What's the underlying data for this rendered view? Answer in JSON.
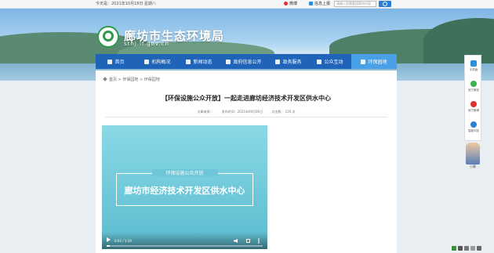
{
  "topbar": {
    "date": "今天是：2021年10月18日 星期八",
    "weibo_label": "微博",
    "mobile_label": "信息上报",
    "search_placeholder": "请输入您需要搜索的内容"
  },
  "header": {
    "site_title": "廊坊市生态环境局",
    "site_url": "sthj.lf.gov.cn"
  },
  "nav": {
    "items": [
      {
        "label": "首页"
      },
      {
        "label": "机构概况"
      },
      {
        "label": "新闻动态"
      },
      {
        "label": "政府信息公开"
      },
      {
        "label": "政务服务"
      },
      {
        "label": "公众互动"
      },
      {
        "label": "环保园地"
      }
    ],
    "active_index": 6
  },
  "breadcrumb": {
    "text": "首页 > 环保园地 > 环保园地"
  },
  "article": {
    "title": "【环保设施公众开放】一起走进廊坊经济技术开发区供水中心",
    "meta_source": "文章来源：",
    "meta_time": "发布时间：2021年09月06日",
    "meta_views": "点击数：  126 次"
  },
  "video": {
    "subtitle": "环保设施公众开放",
    "title": "廊坊市经济技术开发区供水中心",
    "time": "0:02 / 1:19",
    "progress": 0.02
  },
  "sidebar": {
    "items": [
      {
        "label": "手机版"
      },
      {
        "label": "官方微信"
      },
      {
        "label": "官方微博"
      },
      {
        "label": "智能问答"
      }
    ],
    "mascot_label": "小廊"
  },
  "colors": {
    "nav_bg": "#1f64b8",
    "nav_active": "#4aa0e6",
    "logo_green": "#2e9a4a"
  }
}
